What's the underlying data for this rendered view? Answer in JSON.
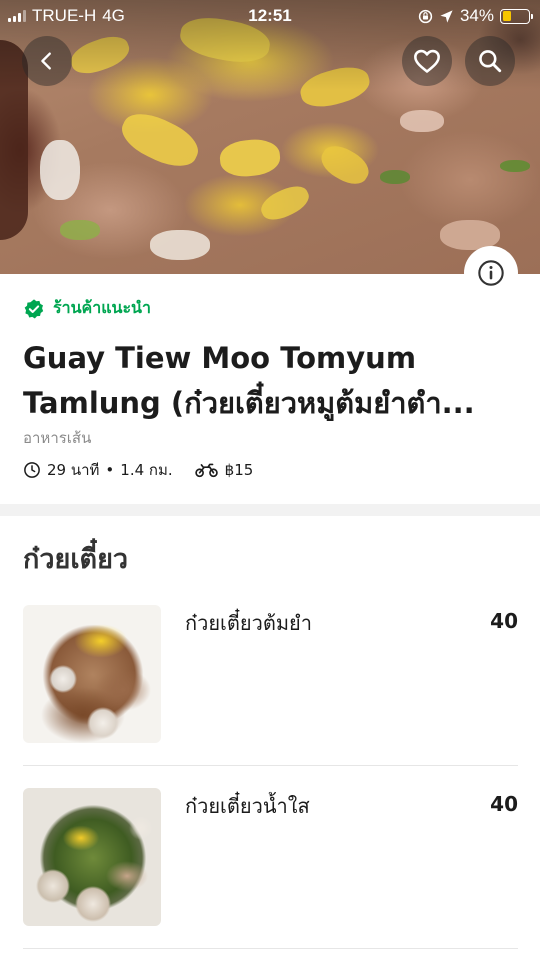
{
  "status_bar": {
    "carrier": "TRUE-H",
    "network": "4G",
    "time": "12:51",
    "battery": "34%",
    "battery_level": 0.34,
    "battery_color": "#f7c600"
  },
  "hero": {
    "icons": [
      "back-arrow-icon",
      "heart-icon",
      "search-icon",
      "info-icon"
    ]
  },
  "merchant": {
    "badge_label": "ร้านค้าแนะนำ",
    "badge_color": "#00a651",
    "name_line1": "Guay Tiew Moo Tomyum",
    "name_line2": "Tamlung (ก๋วยเตี๋ยวหมูต้มยำตำ...",
    "cuisine": "อาหารเส้น",
    "delivery_time": "29 นาที",
    "distance": "1.4 กม.",
    "delivery_fee": "฿15"
  },
  "menu": {
    "section_title": "ก๋วยเตี๋ยว",
    "items": [
      {
        "name": "ก๋วยเตี๋ยวต้มยำ",
        "price": "40"
      },
      {
        "name": "ก๋วยเตี๋ยวน้ำใส",
        "price": "40"
      }
    ]
  }
}
